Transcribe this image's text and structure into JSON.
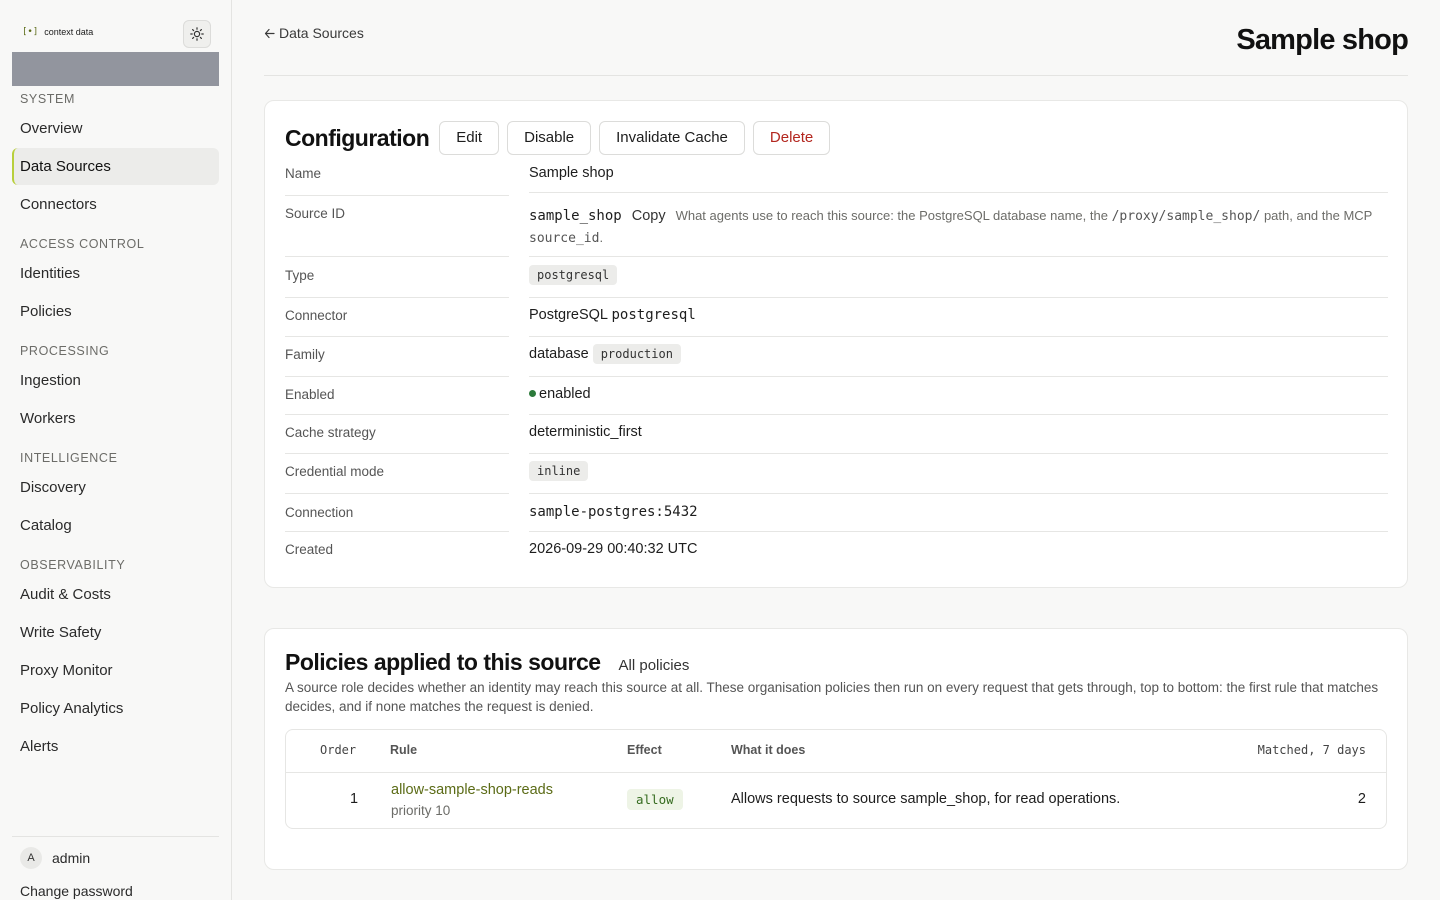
{
  "brand": {
    "mark": "[•]",
    "name": "context data"
  },
  "sidebar": {
    "sections": [
      {
        "title": "SYSTEM",
        "items": [
          "Overview",
          "Data Sources",
          "Connectors"
        ]
      },
      {
        "title": "ACCESS CONTROL",
        "items": [
          "Identities",
          "Policies"
        ]
      },
      {
        "title": "PROCESSING",
        "items": [
          "Ingestion",
          "Workers"
        ]
      },
      {
        "title": "INTELLIGENCE",
        "items": [
          "Discovery",
          "Catalog"
        ]
      },
      {
        "title": "OBSERVABILITY",
        "items": [
          "Audit & Costs",
          "Write Safety",
          "Proxy Monitor",
          "Policy Analytics",
          "Alerts"
        ]
      }
    ],
    "active_item": "Data Sources",
    "user": {
      "initial": "A",
      "name": "admin"
    },
    "change_password": "Change password"
  },
  "header": {
    "back_label": "Data Sources",
    "title": "Sample shop"
  },
  "config": {
    "title": "Configuration",
    "buttons": {
      "edit": "Edit",
      "disable": "Disable",
      "invalidate": "Invalidate Cache",
      "delete": "Delete"
    },
    "labels": {
      "name": "Name",
      "source_id": "Source ID",
      "type": "Type",
      "connector": "Connector",
      "family": "Family",
      "enabled": "Enabled",
      "cache_strategy": "Cache strategy",
      "credential_mode": "Credential mode",
      "connection": "Connection",
      "created": "Created"
    },
    "values": {
      "name": "Sample shop",
      "source_id": "sample_shop",
      "copy": "Copy",
      "hint_1": "What agents use to reach this source: the PostgreSQL database name, the",
      "hint_code_1": "/proxy/sample_shop/",
      "hint_2": "path, and the MCP",
      "hint_code_2": "source_id",
      "hint_3": ".",
      "type": "postgresql",
      "connector_name": "PostgreSQL",
      "connector_code": "postgresql",
      "family": "database",
      "family_tag": "production",
      "enabled": "enabled",
      "cache_strategy": "deterministic_first",
      "credential_mode": "inline",
      "connection": "sample-postgres:5432",
      "created": "2026-09-29 00:40:32 UTC"
    }
  },
  "policies": {
    "title": "Policies applied to this source",
    "all_link": "All policies",
    "description": "A source role decides whether an identity may reach this source at all. These organisation policies then run on every request that gets through, top to bottom: the first rule that matches decides, and if none matches the request is denied.",
    "columns": {
      "order": "Order",
      "rule": "Rule",
      "effect": "Effect",
      "what": "What it does",
      "matched": "Matched, 7 days"
    },
    "rows": [
      {
        "order": "1",
        "rule": "allow-sample-shop-reads",
        "priority": "priority 10",
        "effect": "allow",
        "what": "Allows requests to source sample_shop, for read operations.",
        "matched": "2"
      }
    ]
  }
}
